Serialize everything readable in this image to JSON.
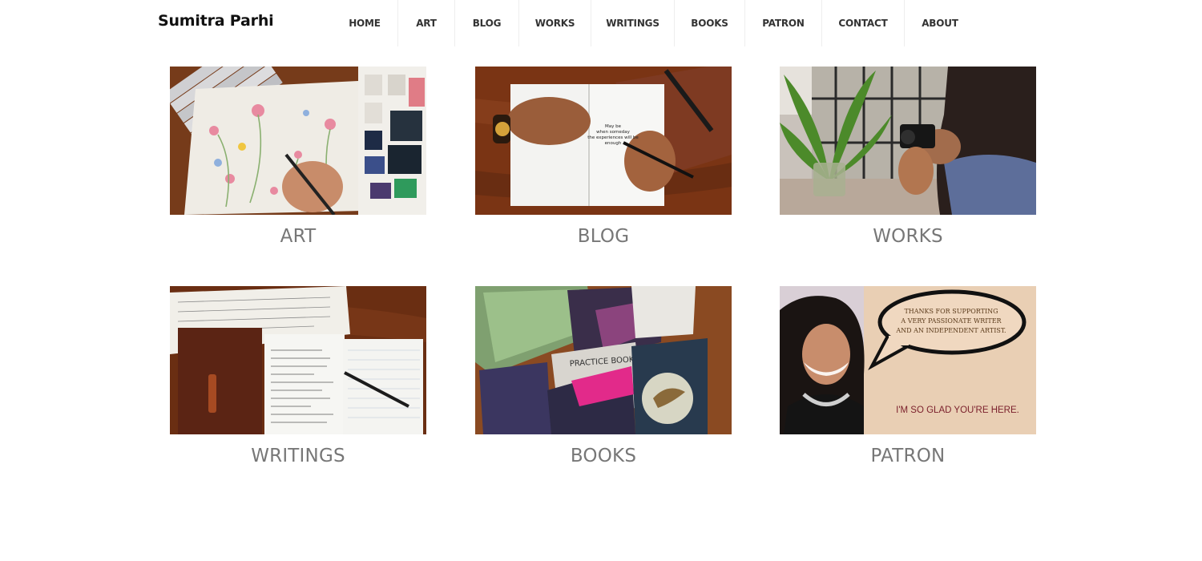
{
  "site": {
    "title": "Sumitra Parhi"
  },
  "nav": {
    "items": [
      {
        "label": "HOME"
      },
      {
        "label": "ART"
      },
      {
        "label": "BLOG"
      },
      {
        "label": "WORKS"
      },
      {
        "label": "WRITINGS"
      },
      {
        "label": "BOOKS"
      },
      {
        "label": "PATRON"
      },
      {
        "label": "CONTACT"
      },
      {
        "label": "ABOUT"
      }
    ]
  },
  "tiles": [
    {
      "caption": "ART"
    },
    {
      "caption": "BLOG",
      "note_text": [
        "May be",
        "when someday",
        "the experiences will be",
        "enough"
      ]
    },
    {
      "caption": "WORKS"
    },
    {
      "caption": "WRITINGS"
    },
    {
      "caption": "BOOKS",
      "book_text": [
        "PRACTICE BOOK"
      ]
    },
    {
      "caption": "PATRON",
      "bubble_text": [
        "THANKS FOR SUPPORTING",
        "A VERY  PASSIONATE WRITER",
        "AND AN INDEPENDENT ARTIST."
      ],
      "tagline": "I'M SO GLAD YOU'RE HERE."
    }
  ],
  "colors": {
    "caption": "#777777",
    "nav_text": "#333333",
    "title": "#111111",
    "wood": "#7a3a1c",
    "patron_bg": "#e9cfb4",
    "patron_tagline": "#7a1f2b"
  }
}
